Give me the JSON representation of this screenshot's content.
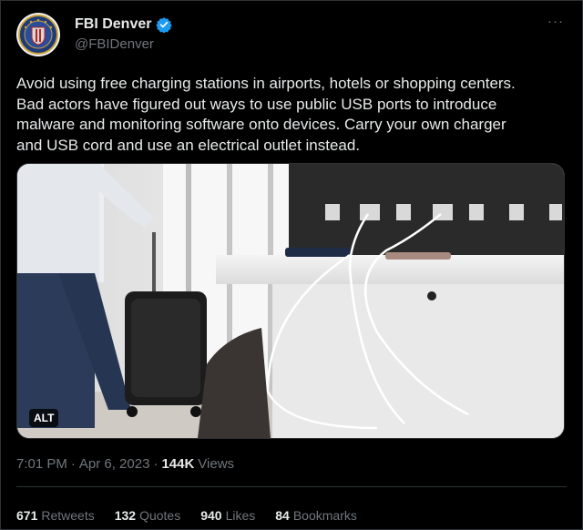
{
  "author": {
    "display_name": "FBI Denver",
    "handle": "@FBIDenver",
    "avatar_icon": "fbi-seal-icon",
    "verified_icon": "verified-badge-icon",
    "verified_color": "#1d9bf0"
  },
  "more_icon": "more-options-icon",
  "more_label": "···",
  "tweet": {
    "text": "Avoid using free charging stations in airports, hotels or shopping centers.\nBad actors have figured out ways to use public USB ports to introduce\nmalware and monitoring software onto devices. Carry your own charger\nand USB cord and use an electrical outlet instead."
  },
  "media": {
    "alt_label": "ALT"
  },
  "meta": {
    "time": "7:01 PM",
    "separator": "·",
    "date": "Apr 6, 2023",
    "views_count": "144K",
    "views_label": "Views"
  },
  "stats": {
    "retweets_count": "671",
    "retweets_label": "Retweets",
    "quotes_count": "132",
    "quotes_label": "Quotes",
    "likes_count": "940",
    "likes_label": "Likes",
    "bookmarks_count": "84",
    "bookmarks_label": "Bookmarks"
  },
  "colors": {
    "background": "#000000",
    "text": "#e7e9ea",
    "secondary_text": "#71767b",
    "border": "#2f3336"
  }
}
